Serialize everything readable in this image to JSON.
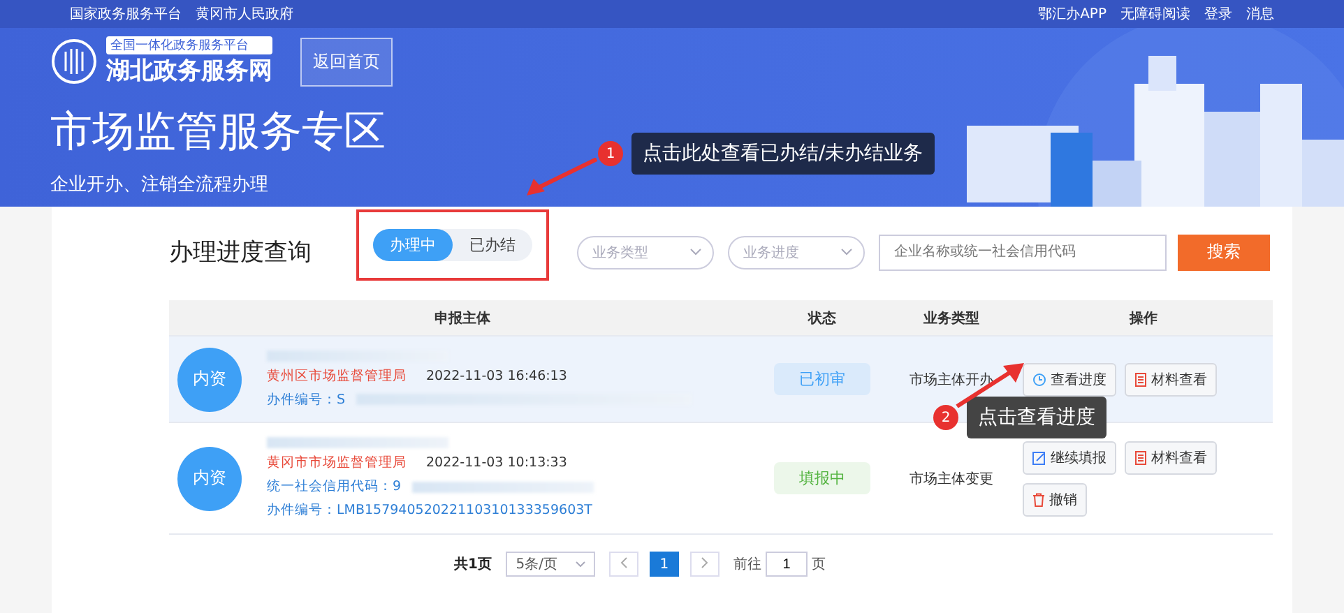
{
  "top_bar": {
    "left": [
      "国家政务服务平台",
      "黄冈市人民政府"
    ],
    "right": [
      "鄂汇办APP",
      "无障碍阅读",
      "登录",
      "消息"
    ]
  },
  "header": {
    "logo_badge": "全国一体化政务服务平台",
    "logo_name": "湖北政务服务网",
    "home_button": "返回首页",
    "title": "市场监管服务专区",
    "subtitle": "企业开办、注销全流程办理"
  },
  "annotations": [
    {
      "number": "1",
      "text": "点击此处查看已办结/未办结业务"
    },
    {
      "number": "2",
      "text": "点击查看进度"
    }
  ],
  "query": {
    "title": "办理进度查询",
    "tabs": [
      {
        "label": "办理中",
        "selected": true
      },
      {
        "label": "已办结",
        "selected": false
      }
    ],
    "filters": [
      {
        "placeholder": "业务类型"
      },
      {
        "placeholder": "业务进度"
      }
    ],
    "search": {
      "placeholder": "企业名称或统一社会信用代码",
      "button": "搜索"
    }
  },
  "table": {
    "columns": [
      "申报主体",
      "状态",
      "业务类型",
      "操作"
    ],
    "rows": [
      {
        "avatar": "内资",
        "selected": true,
        "agency": "黄州区市场监督管理局",
        "time": "2022-11-03 16:46:13",
        "fields": [
          {
            "label": "办件编号：",
            "value": "S"
          }
        ],
        "status": "已初审",
        "color": "#3ea0f6",
        "business": "市场主体开办",
        "actions": [
          {
            "label": "查看进度",
            "kind": "progress"
          },
          {
            "label": "材料查看",
            "kind": "material"
          }
        ]
      },
      {
        "avatar": "内资",
        "selected": false,
        "agency": "黄冈市市场监督管理局",
        "time": "2022-11-03 10:13:33",
        "fields": [
          {
            "label": "统一社会信用代码：",
            "value": "9"
          },
          {
            "label": "办件编号：",
            "value": "LMB15794052022110310133359603T"
          }
        ],
        "status": "填报中",
        "color": "#52b33f",
        "business": "市场主体变更",
        "actions": [
          {
            "label": "继续填报",
            "kind": "edit"
          },
          {
            "label": "材料查看",
            "kind": "material"
          },
          {
            "label": "撤销",
            "kind": "delete"
          }
        ]
      }
    ]
  },
  "pagination": {
    "total": "共1页",
    "page_size": "5条/页",
    "pages": [
      {
        "label": "1",
        "selected": true
      }
    ],
    "goto_label": "前往",
    "goto_value": "1",
    "goto_suffix": "页"
  }
}
